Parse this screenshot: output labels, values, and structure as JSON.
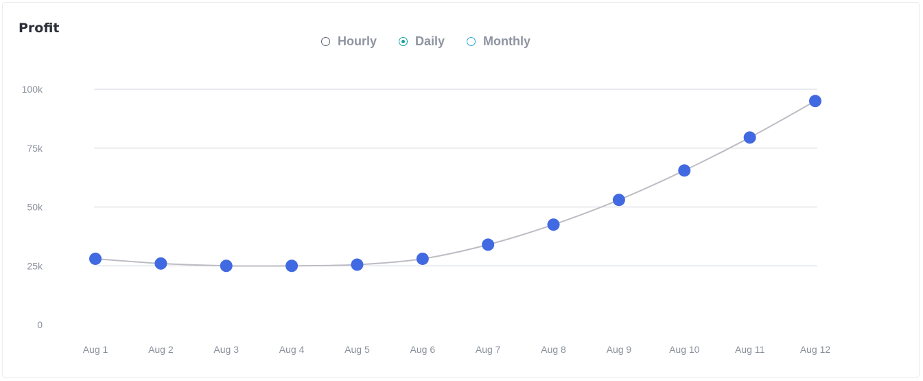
{
  "header": {
    "title": "Profit"
  },
  "toggle": {
    "options": [
      {
        "label": "Hourly",
        "selected": false,
        "ring_color": "#5b6170"
      },
      {
        "label": "Daily",
        "selected": true,
        "ring_color": "#16a3a0"
      },
      {
        "label": "Monthly",
        "selected": false,
        "ring_color": "#2ea8d8"
      }
    ]
  },
  "colors": {
    "point": "#4169e1",
    "line": "#bcbcc4",
    "grid": "#e2e4e8",
    "tick": "#8a909b"
  },
  "chart_data": {
    "type": "line",
    "title": "Profit",
    "xlabel": "",
    "ylabel": "",
    "categories": [
      "Aug 1",
      "Aug 2",
      "Aug 3",
      "Aug 4",
      "Aug 5",
      "Aug 6",
      "Aug 7",
      "Aug 8",
      "Aug 9",
      "Aug 10",
      "Aug 11",
      "Aug 12"
    ],
    "values": [
      28000,
      26000,
      25000,
      25000,
      25500,
      28000,
      34000,
      42500,
      53000,
      65500,
      79500,
      95000
    ],
    "ylim": [
      0,
      100000
    ],
    "yticks": [
      0,
      25000,
      50000,
      75000,
      100000
    ],
    "ytick_labels": [
      "0",
      "25k",
      "50k",
      "75k",
      "100k"
    ],
    "grid": true,
    "smooth": true,
    "legend": "none"
  }
}
